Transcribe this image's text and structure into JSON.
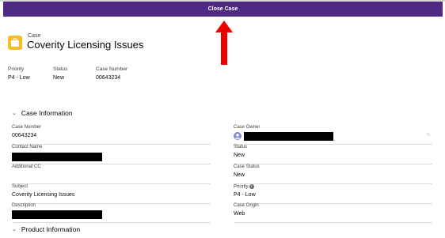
{
  "action_bar": {
    "close_case_label": "Close Case"
  },
  "record_header": {
    "object_type": "Case",
    "title": "Coverity Licensing Issues",
    "icon": "briefcase-icon",
    "highlights": [
      {
        "label": "Priority",
        "value": "P4 - Low"
      },
      {
        "label": "Status",
        "value": "New"
      },
      {
        "label": "Case Number",
        "value": "00643234"
      }
    ]
  },
  "sections": {
    "case_information": "Case Information",
    "product_information": "Product Information"
  },
  "fields_left": [
    {
      "label": "Case Number",
      "value": "00643234"
    },
    {
      "label": "Contact Name",
      "value": ""
    },
    {
      "label": "Additional CC",
      "value": ""
    },
    {
      "label": "Subject",
      "value": "Coverity Licensing Issues"
    },
    {
      "label": "Description",
      "value": ""
    }
  ],
  "fields_right": [
    {
      "label": "Case Owner",
      "value": ""
    },
    {
      "label": "Status",
      "value": "New"
    },
    {
      "label": "Case Status",
      "value": "New"
    },
    {
      "label": "Priority",
      "value": "P4 - Low"
    },
    {
      "label": "Case Origin",
      "value": "Web"
    }
  ],
  "colors": {
    "action_bar": "#4e2a84",
    "arrow": "#ee0000",
    "case_icon": "#f4bc25"
  }
}
